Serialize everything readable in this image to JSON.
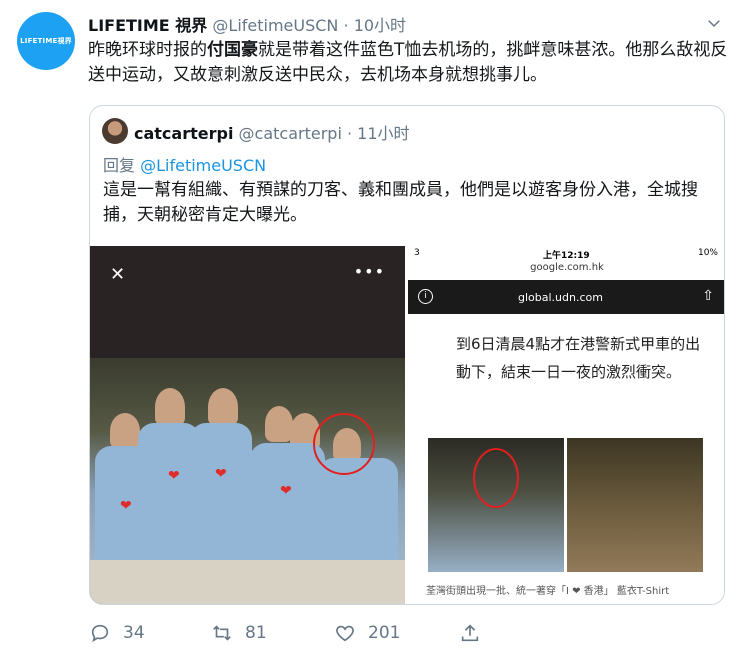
{
  "tweet": {
    "avatar_text": "LIFETIME視界",
    "name": "LIFETIME 視界",
    "handle": "@LifetimeUSCN",
    "dot": "·",
    "time": "10小时",
    "text_before": "昨晚环球时报的",
    "text_bold": "付国豪",
    "text_after": "就是带着这件蓝色T恤去机场的，挑衅意味甚浓。他那么敌视反送中运动，又故意刺激反送中民众，去机场本身就想挑事儿。"
  },
  "quote": {
    "name": "catcarterpi",
    "handle": "@catcarterpi",
    "dot": "·",
    "time": "11小时",
    "reply_prefix": "回复",
    "reply_mention": "@LifetimeUSCN",
    "text": "這是一幫有組織、有預謀的刀客、義和團成員，他們是以遊客身份入港，全城搜捕，天朝秘密肯定大曝光。"
  },
  "phone": {
    "status_left": "3",
    "status_time": "上午12:19",
    "status_right": "10%",
    "url": "google.com.hk",
    "site": "global.udn.com",
    "article": "到6日清晨4點才在港警新式甲車的出動下，結束一日一夜的激烈衝突。",
    "caption": "荃灣街頭出現一批、統一著穿「I ❤ 香港」 藍衣T-Shirt"
  },
  "actions": {
    "replies": "34",
    "retweets": "81",
    "likes": "201"
  }
}
